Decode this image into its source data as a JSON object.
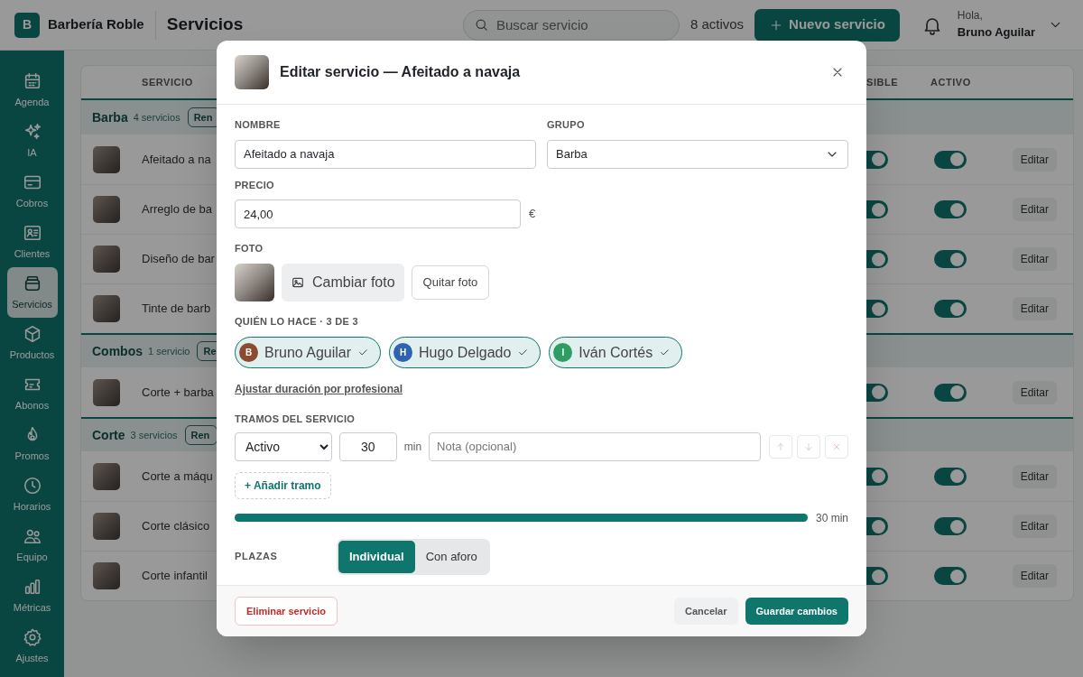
{
  "brand": {
    "initial": "B",
    "name": "Barbería Roble"
  },
  "page_title": "Servicios",
  "search": {
    "placeholder": "Buscar servicio"
  },
  "active_count": "8 activos",
  "new_button": "Nuevo servicio",
  "user": {
    "greeting": "Hola,",
    "name": "Bruno Aguilar"
  },
  "sidebar": {
    "items": [
      {
        "label": "Agenda",
        "selected": false
      },
      {
        "label": "IA",
        "selected": false
      },
      {
        "label": "Cobros",
        "selected": false
      },
      {
        "label": "Clientes",
        "selected": false
      },
      {
        "label": "Servicios",
        "selected": true
      },
      {
        "label": "Productos",
        "selected": false
      },
      {
        "label": "Abonos",
        "selected": false
      },
      {
        "label": "Promos",
        "selected": false
      },
      {
        "label": "Horarios",
        "selected": false
      },
      {
        "label": "Equipo",
        "selected": false
      },
      {
        "label": "Métricas",
        "selected": false
      },
      {
        "label": "Ajustes",
        "selected": false
      }
    ]
  },
  "table": {
    "columns": [
      "SERVICIO",
      "SIBLE",
      "ACTIVO"
    ],
    "groups": [
      {
        "name": "Barba",
        "count": "4 servicios",
        "button": "Ren",
        "rows": [
          {
            "name": "Afeitado a na",
            "visible": true,
            "active": true,
            "action": "Editar"
          },
          {
            "name": "Arreglo de ba",
            "visible": true,
            "active": true,
            "action": "Editar"
          },
          {
            "name": "Diseño de bar",
            "visible": true,
            "active": true,
            "action": "Editar"
          },
          {
            "name": "Tinte de barb",
            "visible": true,
            "active": true,
            "action": "Editar"
          }
        ]
      },
      {
        "name": "Combos",
        "count": "1 servicio",
        "button": "Re",
        "rows": [
          {
            "name": "Corte + barba",
            "visible": true,
            "active": true,
            "action": "Editar"
          }
        ]
      },
      {
        "name": "Corte",
        "count": "3 servicios",
        "button": "Ren",
        "rows": [
          {
            "name": "Corte a máqu",
            "visible": true,
            "active": true,
            "action": "Editar"
          },
          {
            "name": "Corte clásico",
            "visible": true,
            "active": true,
            "action": "Editar"
          },
          {
            "name": "Corte infantil",
            "visible": true,
            "active": true,
            "action": "Editar"
          }
        ]
      }
    ]
  },
  "modal": {
    "title": "Editar servicio — Afeitado a navaja",
    "name": {
      "label": "NOMBRE",
      "value": "Afeitado a navaja"
    },
    "group": {
      "label": "GRUPO",
      "value": "Barba"
    },
    "price": {
      "label": "PRECIO",
      "value": "24,00",
      "unit": "€"
    },
    "photo": {
      "label": "FOTO",
      "change_button": "Cambiar foto",
      "remove_button": "Quitar foto"
    },
    "staff": {
      "label": "QUIÉN LO HACE · 3 DE 3",
      "members": [
        {
          "initial": "B",
          "name": "Bruno Aguilar",
          "color": "#8a4b2e",
          "selected": true
        },
        {
          "initial": "H",
          "name": "Hugo Delgado",
          "color": "#2f62b0",
          "selected": true
        },
        {
          "initial": "I",
          "name": "Iván Cortés",
          "color": "#2e9c63",
          "selected": true
        }
      ],
      "link": "Ajustar duración por profesional"
    },
    "segments": {
      "label": "TRAMOS DEL SERVICIO",
      "items": [
        {
          "type": "Activo",
          "minutes": "30",
          "unit": "min",
          "note_placeholder": "Nota (opcional)"
        }
      ],
      "add_button": "+ Añadir tramo",
      "timeline": {
        "level": 1,
        "total": "30 min"
      }
    },
    "capacity": {
      "label": "PLAZAS",
      "options": [
        {
          "label": "Individual",
          "selected": true
        },
        {
          "label": "Con aforo",
          "selected": false
        }
      ]
    },
    "footer": {
      "delete_button": "Eliminar servicio",
      "cancel_button": "Cancelar",
      "save_button": "Guardar cambios"
    }
  }
}
